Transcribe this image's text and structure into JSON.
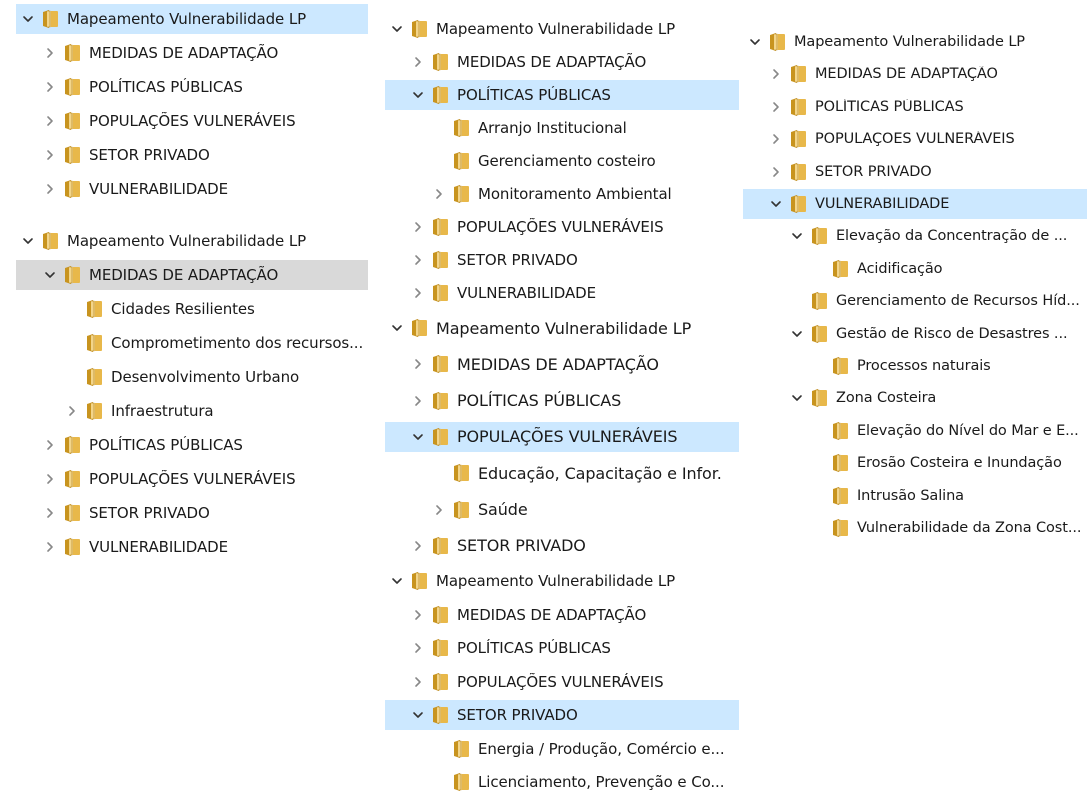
{
  "colors": {
    "selection": "#cce8ff",
    "focus_gray": "#d9d9d9",
    "chevron": "#888888",
    "folder": "#e8b84a"
  },
  "icons": {
    "expanded": "chevron-down-icon",
    "collapsed": "chevron-right-icon",
    "node": "folder-icon"
  },
  "trees": [
    {
      "items": [
        {
          "label": "Mapeamento Vulnerabilidade LP",
          "state": "expanded",
          "level": 0,
          "highlight": "selected"
        },
        {
          "label": "MEDIDAS DE ADAPTAÇÃO",
          "state": "collapsed",
          "level": 1
        },
        {
          "label": "POLÍTICAS PÚBLICAS",
          "state": "collapsed",
          "level": 1
        },
        {
          "label": "POPULAÇÕES VULNERÁVEIS",
          "state": "collapsed",
          "level": 1
        },
        {
          "label": "SETOR PRIVADO",
          "state": "collapsed",
          "level": 1
        },
        {
          "label": "VULNERABILIDADE",
          "state": "collapsed",
          "level": 1
        }
      ]
    },
    {
      "items": [
        {
          "label": "Mapeamento Vulnerabilidade LP",
          "state": "expanded",
          "level": 0
        },
        {
          "label": "MEDIDAS DE ADAPTAÇÃO",
          "state": "expanded",
          "level": 1,
          "highlight": "focus"
        },
        {
          "label": "Cidades Resilientes",
          "state": "leaf",
          "level": 2
        },
        {
          "label": "Comprometimento dos recursos...",
          "state": "leaf",
          "level": 2
        },
        {
          "label": "Desenvolvimento Urbano",
          "state": "leaf",
          "level": 2
        },
        {
          "label": "Infraestrutura",
          "state": "collapsed",
          "level": 2
        },
        {
          "label": "POLÍTICAS PÚBLICAS",
          "state": "collapsed",
          "level": 1
        },
        {
          "label": "POPULAÇÕES VULNERÁVEIS",
          "state": "collapsed",
          "level": 1
        },
        {
          "label": "SETOR PRIVADO",
          "state": "collapsed",
          "level": 1
        },
        {
          "label": "VULNERABILIDADE",
          "state": "collapsed",
          "level": 1
        }
      ]
    },
    {
      "items": [
        {
          "label": "Mapeamento Vulnerabilidade LP",
          "state": "expanded",
          "level": 0
        },
        {
          "label": "MEDIDAS DE ADAPTAÇÃO",
          "state": "collapsed",
          "level": 1
        },
        {
          "label": "POLÍTICAS PÚBLICAS",
          "state": "expanded",
          "level": 1,
          "highlight": "selected"
        },
        {
          "label": "Arranjo Institucional",
          "state": "leaf",
          "level": 2
        },
        {
          "label": "Gerenciamento costeiro",
          "state": "leaf",
          "level": 2
        },
        {
          "label": "Monitoramento Ambiental",
          "state": "collapsed",
          "level": 2
        },
        {
          "label": "POPULAÇÕES VULNERÁVEIS",
          "state": "collapsed",
          "level": 1
        },
        {
          "label": "SETOR PRIVADO",
          "state": "collapsed",
          "level": 1
        },
        {
          "label": "VULNERABILIDADE",
          "state": "collapsed",
          "level": 1
        }
      ]
    },
    {
      "items": [
        {
          "label": "Mapeamento Vulnerabilidade LP",
          "state": "expanded",
          "level": 0
        },
        {
          "label": "MEDIDAS DE ADAPTAÇÃO",
          "state": "collapsed",
          "level": 1
        },
        {
          "label": "POLÍTICAS PÚBLICAS",
          "state": "collapsed",
          "level": 1
        },
        {
          "label": "POPULAÇÕES VULNERÁVEIS",
          "state": "expanded",
          "level": 1,
          "highlight": "selected"
        },
        {
          "label": "Educação, Capacitação e Infor.",
          "state": "leaf",
          "level": 2
        },
        {
          "label": "Saúde",
          "state": "collapsed",
          "level": 2
        },
        {
          "label": "SETOR PRIVADO",
          "state": "collapsed",
          "level": 1
        }
      ]
    },
    {
      "items": [
        {
          "label": "Mapeamento Vulnerabilidade LP",
          "state": "expanded",
          "level": 0
        },
        {
          "label": "MEDIDAS DE ADAPTAÇÃO",
          "state": "collapsed",
          "level": 1
        },
        {
          "label": "POLÍTICAS PÚBLICAS",
          "state": "collapsed",
          "level": 1
        },
        {
          "label": "POPULAÇÕES VULNERÁVEIS",
          "state": "collapsed",
          "level": 1
        },
        {
          "label": "SETOR PRIVADO",
          "state": "expanded",
          "level": 1,
          "highlight": "selected"
        },
        {
          "label": "Energia / Produção, Comércio e...",
          "state": "leaf",
          "level": 2
        },
        {
          "label": "Licenciamento, Prevenção e Co...",
          "state": "leaf",
          "level": 2
        }
      ]
    },
    {
      "items": [
        {
          "label": "Mapeamento Vulnerabilidade LP",
          "state": "expanded",
          "level": 0
        },
        {
          "label": "MEDIDAS DE ADAPTAÇÃO",
          "state": "collapsed",
          "level": 1
        },
        {
          "label": "POLÍTICAS PÚBLICAS",
          "state": "collapsed",
          "level": 1
        },
        {
          "label": "POPULAÇÕES VULNERÁVEIS",
          "state": "collapsed",
          "level": 1
        },
        {
          "label": "SETOR PRIVADO",
          "state": "collapsed",
          "level": 1
        },
        {
          "label": "VULNERABILIDADE",
          "state": "expanded",
          "level": 1,
          "highlight": "selected"
        },
        {
          "label": "Elevação da Concentração de ...",
          "state": "expanded",
          "level": 2
        },
        {
          "label": "Acidificação",
          "state": "leaf",
          "level": 3
        },
        {
          "label": "Gerenciamento de Recursos Híd...",
          "state": "leaf",
          "level": 2
        },
        {
          "label": "Gestão de Risco de Desastres ...",
          "state": "expanded",
          "level": 2
        },
        {
          "label": "Processos naturais",
          "state": "leaf",
          "level": 3
        },
        {
          "label": "Zona Costeira",
          "state": "expanded",
          "level": 2
        },
        {
          "label": "Elevação do Nível do Mar e E...",
          "state": "leaf",
          "level": 3
        },
        {
          "label": "Erosão Costeira e Inundação",
          "state": "leaf",
          "level": 3
        },
        {
          "label": "Intrusão Salina",
          "state": "leaf",
          "level": 3
        },
        {
          "label": "Vulnerabilidade da Zona Cost...",
          "state": "leaf",
          "level": 3
        }
      ]
    }
  ]
}
